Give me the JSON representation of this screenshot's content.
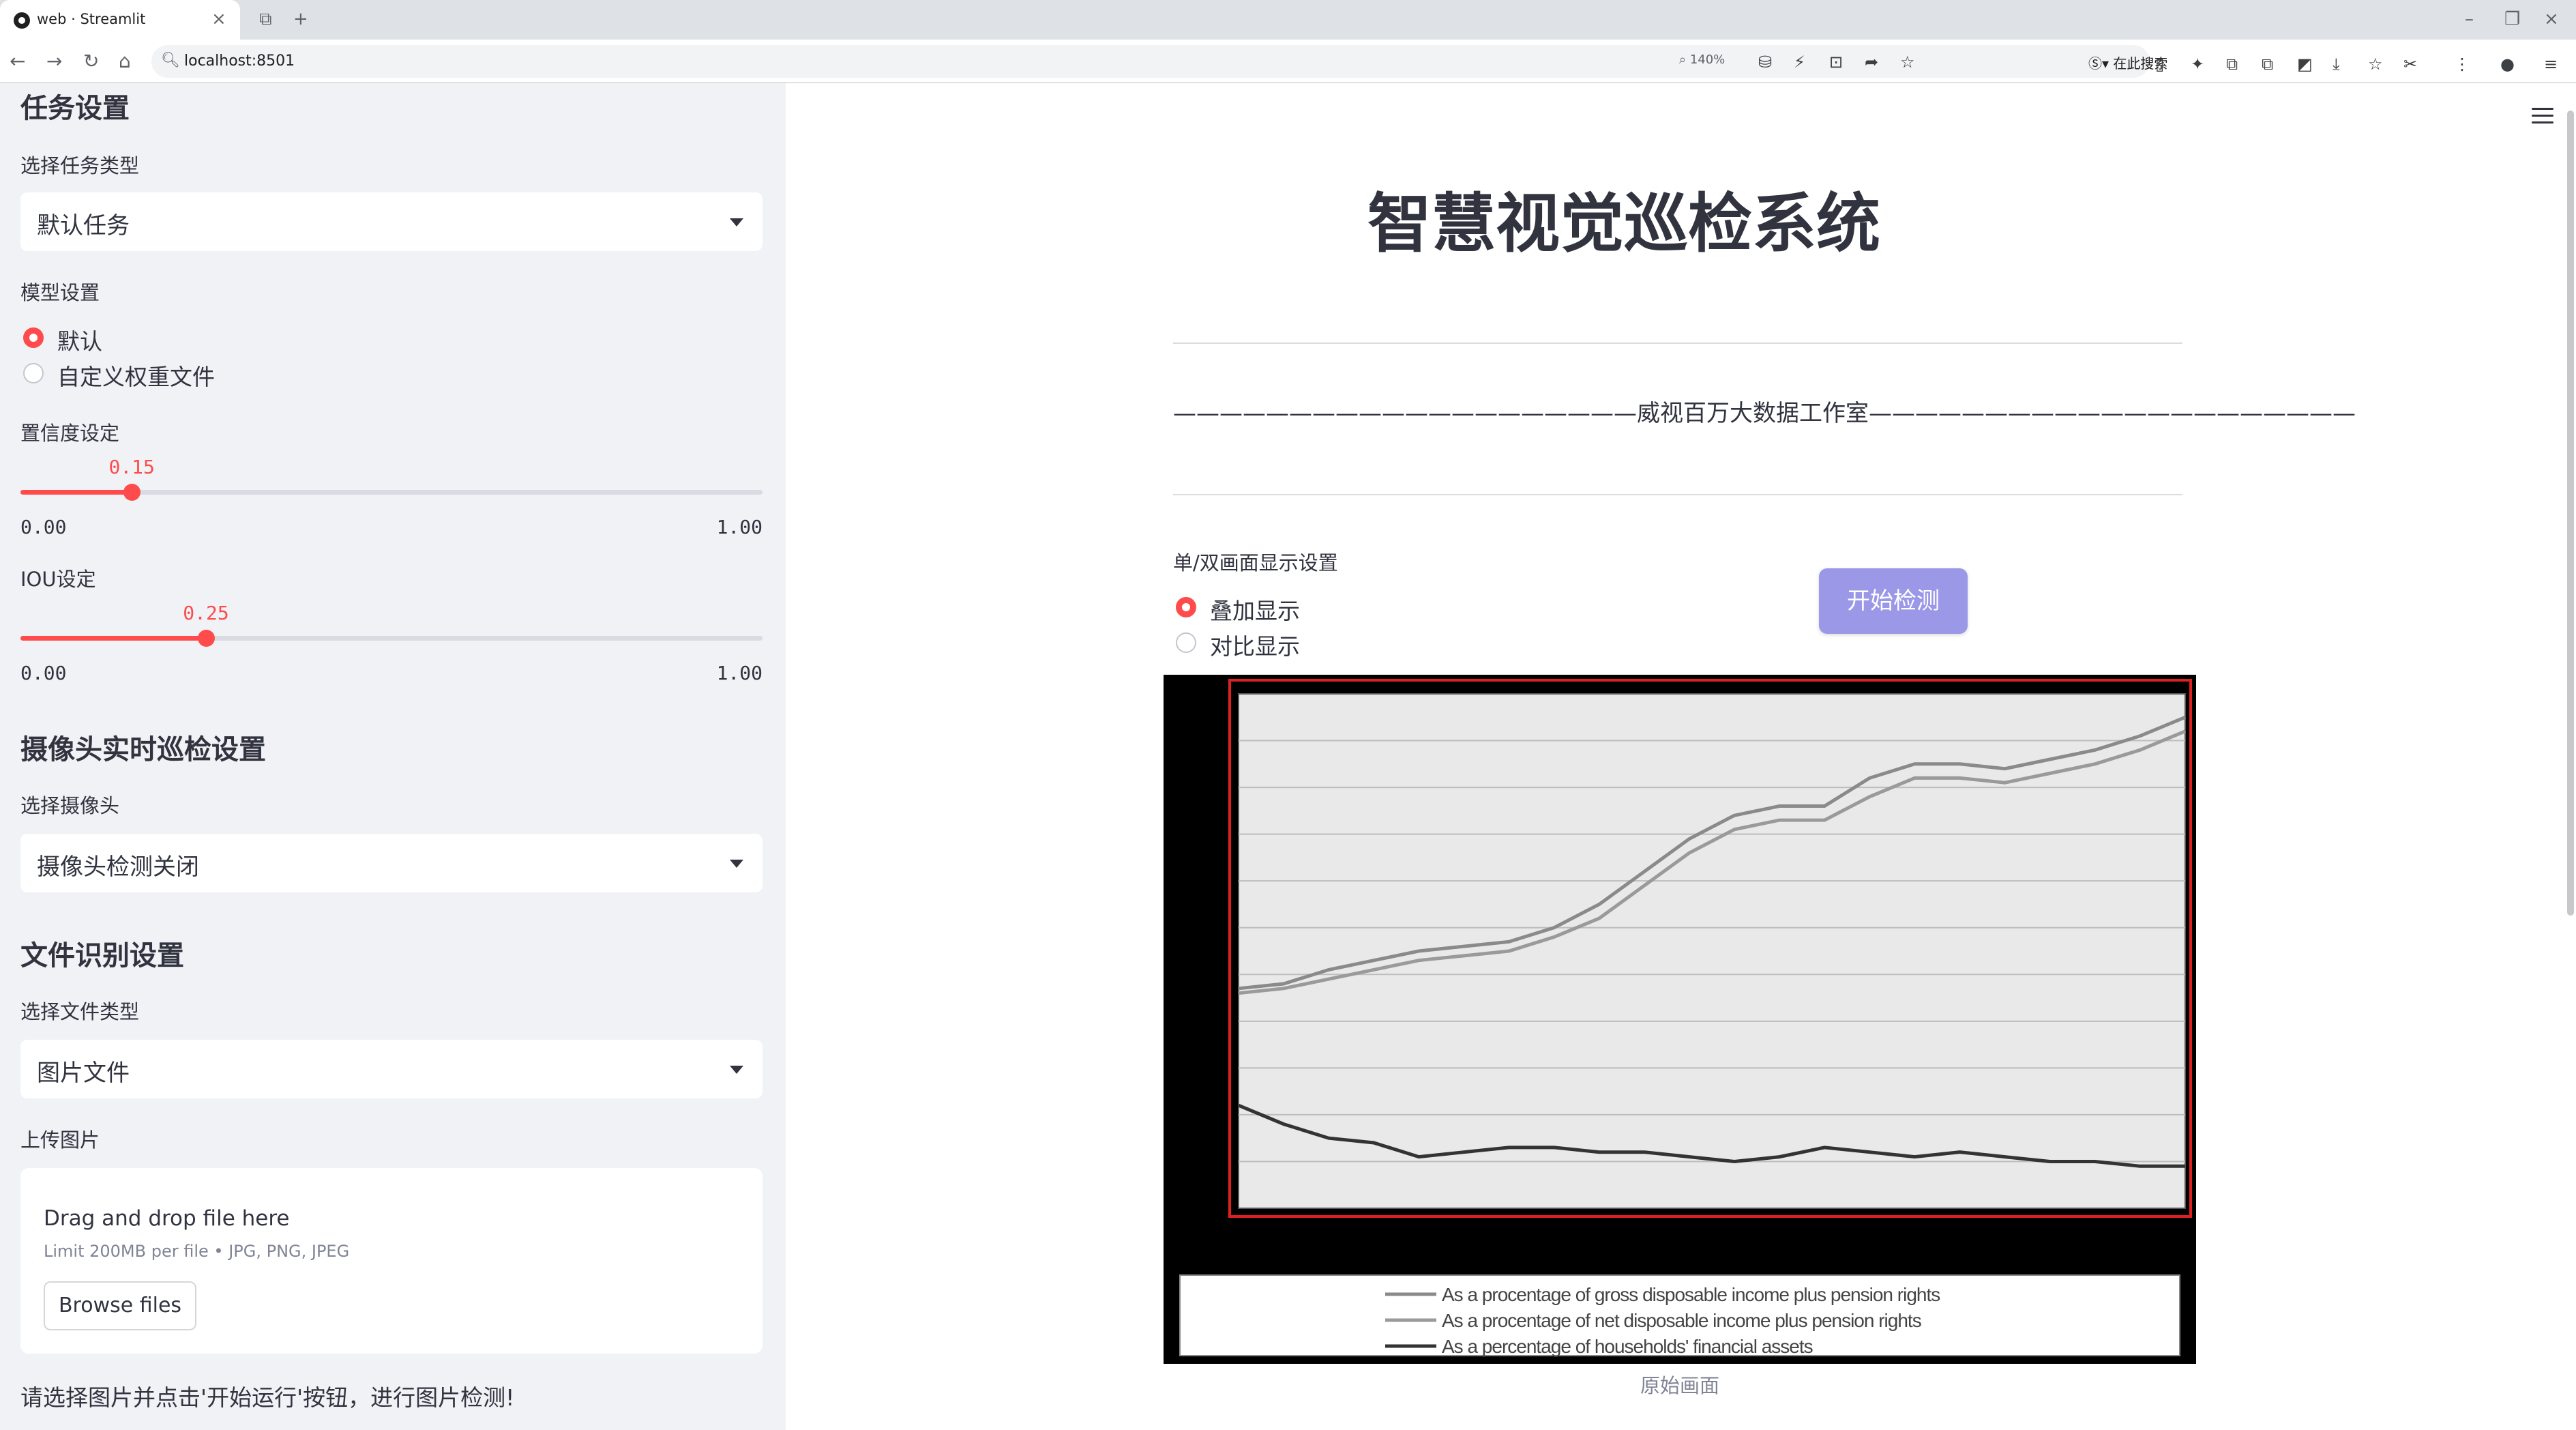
{
  "browser": {
    "tab_title": "web · Streamlit",
    "url": "localhost:8501",
    "zoom": "140%",
    "search_placeholder": "在此搜索"
  },
  "sidebar": {
    "task_heading": "任务设置",
    "task_type_label": "选择任务类型",
    "task_type_value": "默认任务",
    "model_label": "模型设置",
    "model_options": [
      "默认",
      "自定义权重文件"
    ],
    "model_selected": 0,
    "conf": {
      "label": "置信度设定",
      "value": "0.15",
      "fraction": 0.15,
      "min": "0.00",
      "max": "1.00"
    },
    "iou": {
      "label": "IOU设定",
      "value": "0.25",
      "fraction": 0.25,
      "min": "0.00",
      "max": "1.00"
    },
    "camera_heading": "摄像头实时巡检设置",
    "camera_label": "选择摄像头",
    "camera_value": "摄像头检测关闭",
    "file_heading": "文件识别设置",
    "file_type_label": "选择文件类型",
    "file_type_value": "图片文件",
    "upload_label": "上传图片",
    "dropzone_title": "Drag and drop file here",
    "dropzone_limit": "Limit 200MB per file • JPG, PNG, JPEG",
    "browse_label": "Browse files",
    "note": "请选择图片并点击'开始运行'按钮，进行图片检测!"
  },
  "main": {
    "title": "智慧视觉巡检系统",
    "subtitle": "————————————————————威视百万大数据工作室—————————————————————",
    "display_label": "单/双画面显示设置",
    "display_options": [
      "叠加显示",
      "对比显示"
    ],
    "display_selected": 0,
    "start_button": "开始检测",
    "image_caption": "原始画面"
  },
  "colors": {
    "accent": "#ff4b4b",
    "button": "#9b98e8",
    "sidebar_bg": "#f0f2f6",
    "detection_box": "#e02020"
  },
  "chart_data": {
    "type": "line",
    "x": [
      0,
      1,
      2,
      3,
      4,
      5,
      6,
      7,
      8,
      9,
      10,
      11,
      12,
      13,
      14,
      15,
      16,
      17,
      18,
      19,
      20,
      21
    ],
    "series": [
      {
        "name": "As a procentage of gross disposable income plus pension rights",
        "values": [
          47,
          48,
          51,
          53,
          55,
          56,
          57,
          60,
          65,
          72,
          79,
          84,
          86,
          86,
          92,
          95,
          95,
          94,
          96,
          98,
          101,
          105
        ]
      },
      {
        "name": "As a procentage of net disposable income plus pension rights",
        "values": [
          46,
          47,
          49,
          51,
          53,
          54,
          55,
          58,
          62,
          69,
          76,
          81,
          83,
          83,
          88,
          92,
          92,
          91,
          93,
          95,
          98,
          102
        ]
      },
      {
        "name": "As a percentage of households' financial assets",
        "values": [
          22,
          18,
          15,
          14,
          11,
          12,
          13,
          13,
          12,
          12,
          11,
          10,
          11,
          13,
          12,
          11,
          12,
          11,
          10,
          10,
          9,
          9
        ]
      }
    ],
    "ylim": [
      0,
      110
    ]
  }
}
